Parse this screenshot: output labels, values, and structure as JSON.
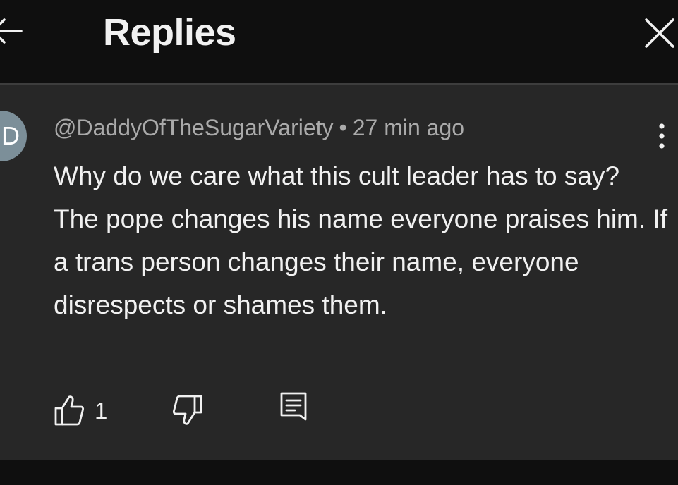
{
  "header": {
    "title": "Replies",
    "back_icon": "arrow-left-icon",
    "close_icon": "close-icon"
  },
  "comment": {
    "avatar_letter": "D",
    "avatar_color": "#7c8f99",
    "author": "@DaddyOfTheSugarVariety",
    "separator": "•",
    "time": "27 min ago",
    "text_line1": "Why do we care what this cult leader has to say?",
    "text_line2": "The pope changes his name everyone praises him. If a trans person changes their name, everyone disrespects or shames them.",
    "like_count": "1",
    "more_icon": "more-vertical-icon",
    "like_icon": "thumbs-up-icon",
    "dislike_icon": "thumbs-down-icon",
    "reply_icon": "reply-comment-icon"
  },
  "colors": {
    "background": "#0f0f0f",
    "panel": "#272727",
    "text_primary": "#f1f1f1",
    "text_secondary": "#aaaaaa"
  }
}
